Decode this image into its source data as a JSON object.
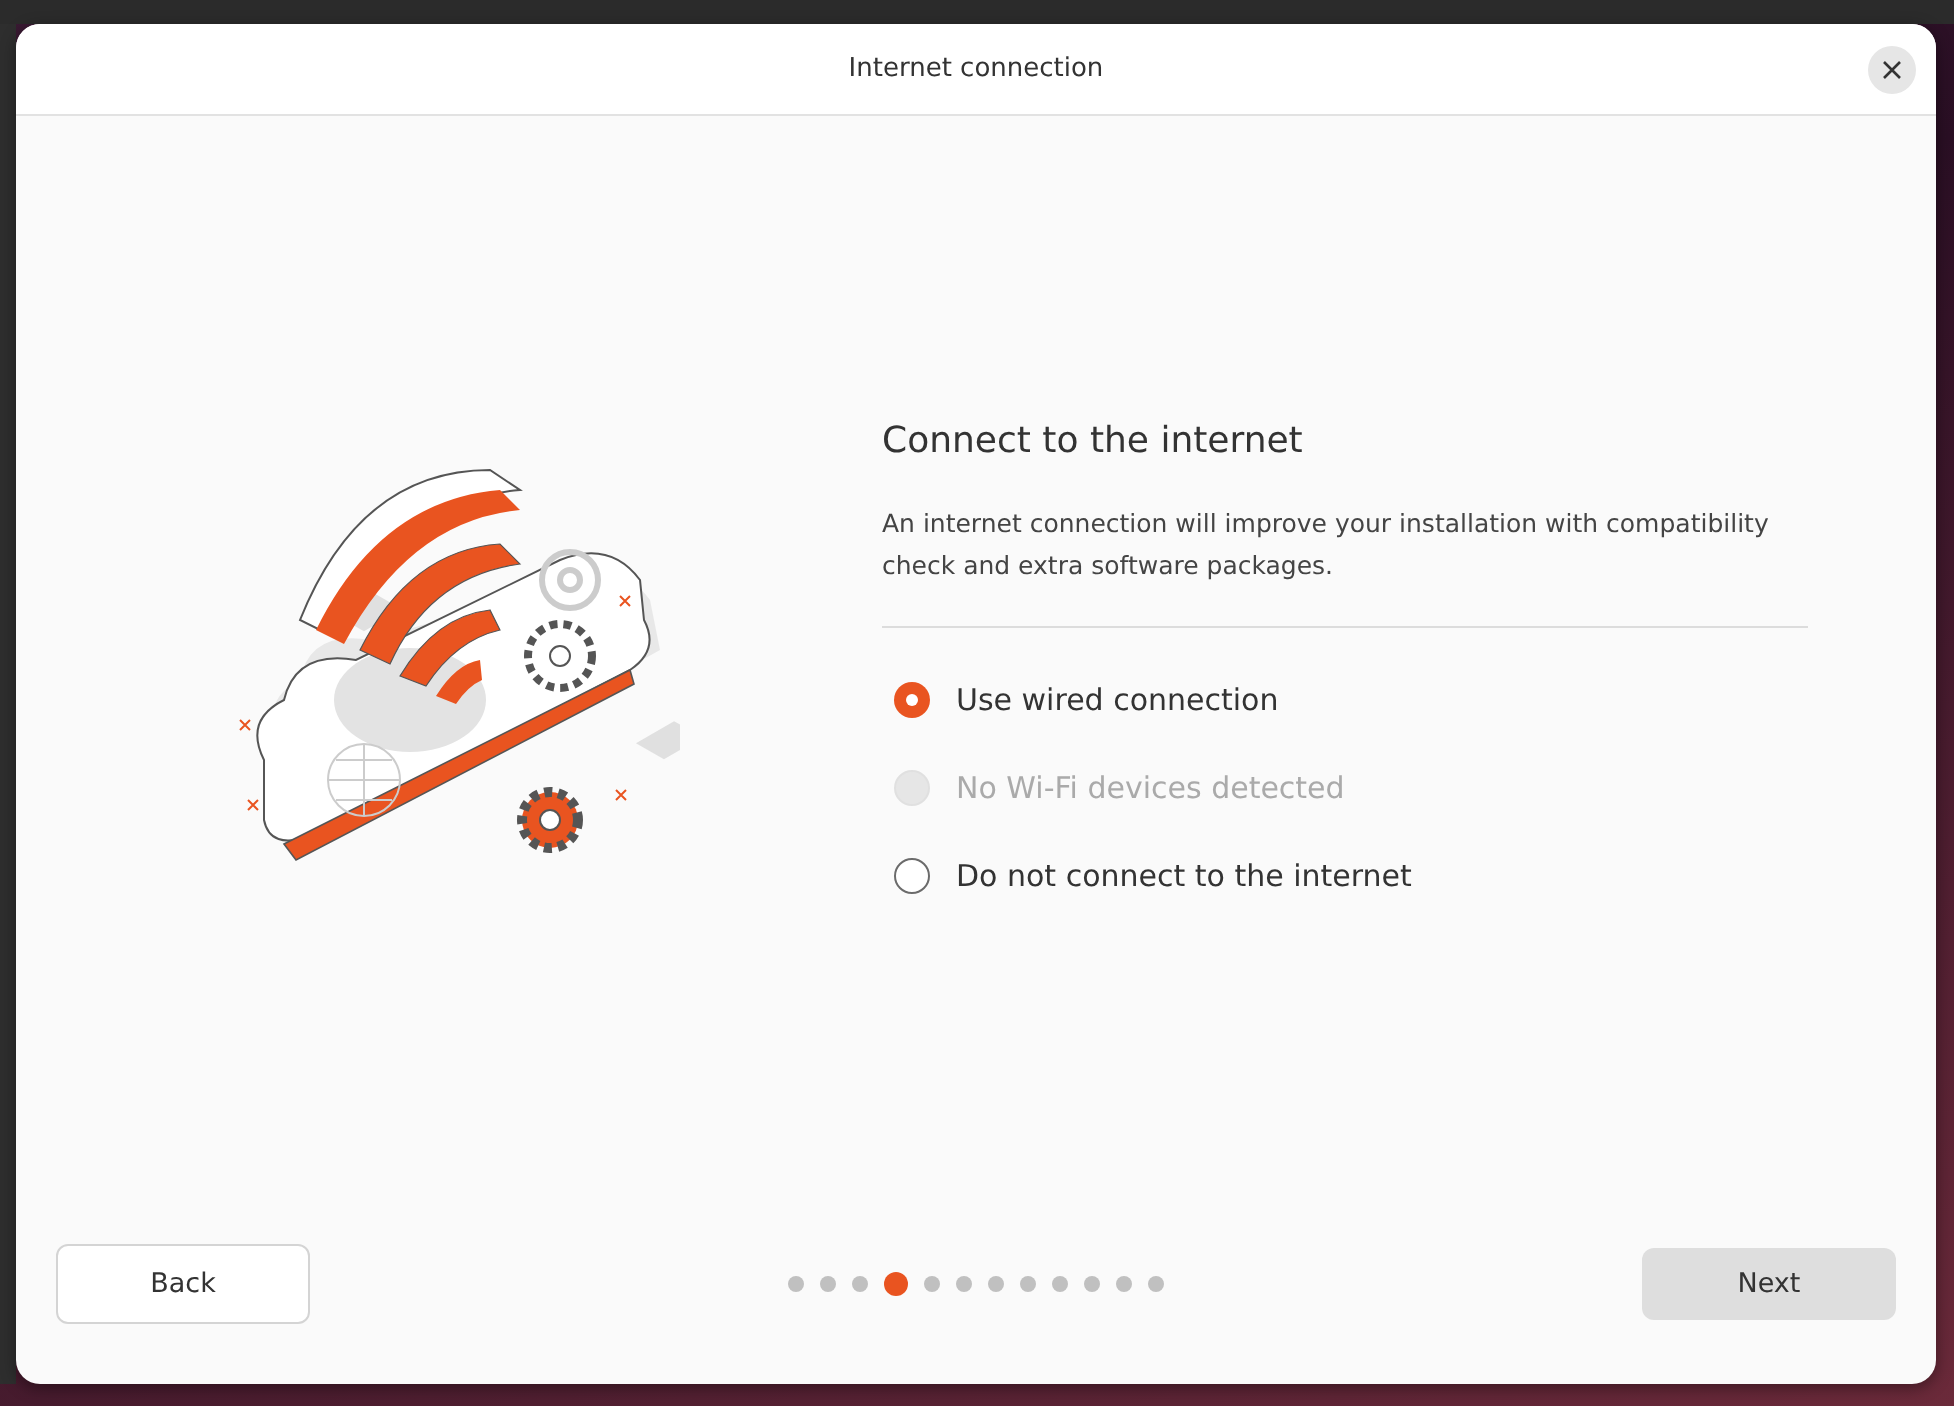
{
  "window": {
    "title": "Internet connection"
  },
  "heading": "Connect to the internet",
  "description": "An internet connection will improve your installation with compatibility check and extra software packages.",
  "options": [
    {
      "label": "Use wired connection",
      "selected": true,
      "disabled": false
    },
    {
      "label": "No Wi-Fi devices detected",
      "selected": false,
      "disabled": true
    },
    {
      "label": "Do not connect to the internet",
      "selected": false,
      "disabled": false
    }
  ],
  "steps": [
    {
      "selected": false
    },
    {
      "selected": false
    },
    {
      "selected": false
    },
    {
      "selected": true
    },
    {
      "selected": false
    },
    {
      "selected": false
    },
    {
      "selected": false
    },
    {
      "selected": false
    },
    {
      "selected": false
    },
    {
      "selected": false
    },
    {
      "selected": false
    },
    {
      "selected": false
    }
  ],
  "buttons": {
    "back": "Back",
    "next": "Next"
  }
}
